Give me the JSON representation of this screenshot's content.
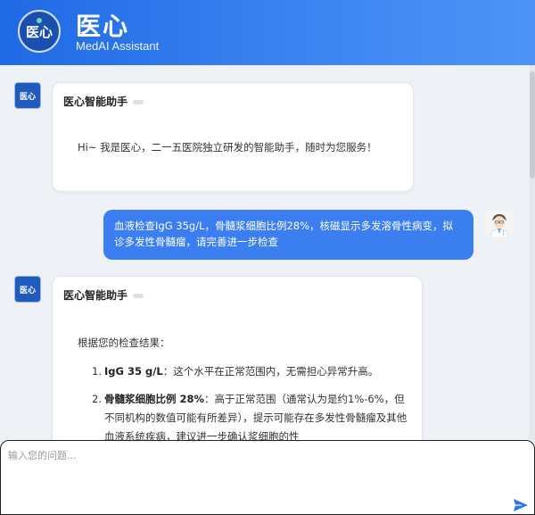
{
  "header": {
    "logo_text": "医心",
    "title": "医心",
    "subtitle": "MedAI Assistant"
  },
  "messages": {
    "greeting": {
      "sender": "医心智能助手",
      "avatar_text": "医心",
      "text": "Hi~ 我是医心，二一五医院独立研发的智能助手，随时为您服务！"
    },
    "user": {
      "text": "血液检查IgG 35g/L，骨髓浆细胞比例28%，核磁显示多发溶骨性病变，拟诊多发性骨髓瘤，请完善进一步检查"
    },
    "reply": {
      "sender": "医心智能助手",
      "avatar_text": "医心",
      "intro": "根据您的检查结果：",
      "items": [
        {
          "num": "1.",
          "bold": "IgG 35 g/L",
          "text": "：这个水平在正常范围内，无需担心异常升高。"
        },
        {
          "num": "2.",
          "bold": "骨髓浆细胞比例 28%",
          "text": "：高于正常范围（通常认为是约1%-6%，但不同机构的数值可能有所差异），提示可能存在多发性骨髓瘤及其他血液系统疾病，建议进一步确认浆细胞的性"
        }
      ]
    }
  },
  "input": {
    "placeholder": "输入您的问题..."
  },
  "colors": {
    "brand_blue": "#2f74ea",
    "user_bubble": "#3a7ef0",
    "page_bg": "#eef1f6"
  },
  "icons": {
    "send": "send-icon",
    "user_avatar": "doctor-avatar-icon"
  }
}
